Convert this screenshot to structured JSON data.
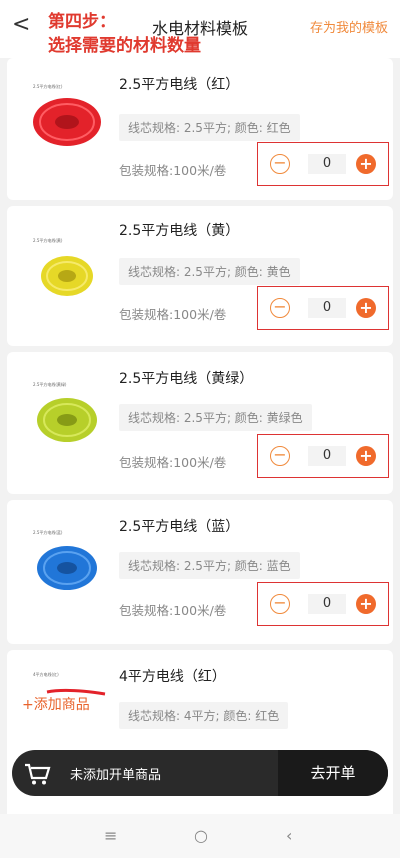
{
  "header": {
    "back_label": "<",
    "title": "水电材料模板",
    "save_label": "存为我的模板"
  },
  "annotation": {
    "line1": "第四步：",
    "line2": "选择需要的材料数量"
  },
  "products": [
    {
      "name": "2.5平方电线（红）",
      "spec": "线芯规格: 2.5平方; 颜色: 红色",
      "package": "包装规格:100米/卷",
      "qty": "0",
      "img_label": "2.5平方电线(红)",
      "color": "#e3222a"
    },
    {
      "name": "2.5平方电线（黄）",
      "spec": "线芯规格: 2.5平方; 颜色: 黄色",
      "package": "包装规格:100米/卷",
      "qty": "0",
      "img_label": "2.5平方电线(黄)",
      "color": "#e6d827"
    },
    {
      "name": "2.5平方电线（黄绿）",
      "spec": "线芯规格: 2.5平方; 颜色: 黄绿色",
      "package": "包装规格:100米/卷",
      "qty": "0",
      "img_label": "2.5平方电线(黄绿)",
      "color": "#b7cf2a"
    },
    {
      "name": "2.5平方电线（蓝）",
      "spec": "线芯规格: 2.5平方; 颜色: 蓝色",
      "package": "包装规格:100米/卷",
      "qty": "0",
      "img_label": "2.5平方电线(蓝)",
      "color": "#2176d8"
    },
    {
      "name": "4平方电线（红）",
      "spec": "线芯规格: 4平方; 颜色: 红色",
      "img_label": "4平方电线(红)",
      "color": "#e3222a"
    }
  ],
  "stepper": {
    "minus": "−",
    "plus": "+"
  },
  "add_goods": "+添加商品",
  "cart": {
    "empty_text": "未添加开单商品",
    "checkout_label": "去开单"
  },
  "navbar": {
    "menu": "≡",
    "home": "○",
    "back": "‹"
  }
}
